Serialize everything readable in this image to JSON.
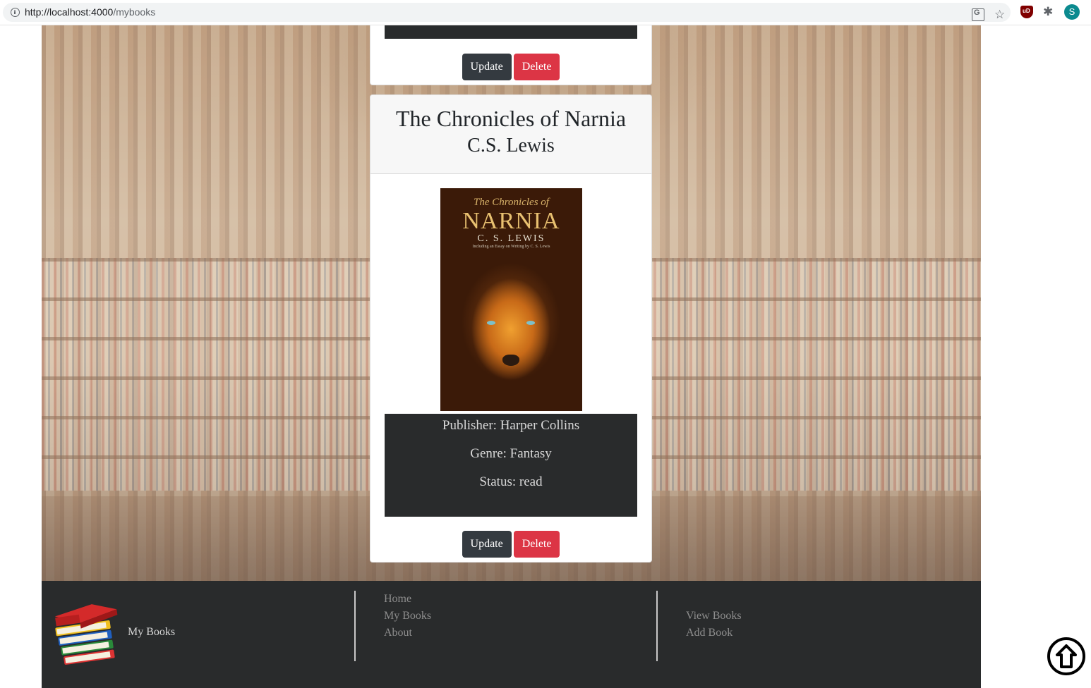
{
  "browser": {
    "url_host": "http://localhost:4000",
    "url_path": "/mybooks",
    "profile_initial": "S"
  },
  "top_card": {
    "update_label": "Update",
    "delete_label": "Delete"
  },
  "book": {
    "title": "The Chronicles of Narnia",
    "author": "C.S. Lewis",
    "cover": {
      "small_title": "The Chronicles of",
      "big_title": "NARNIA",
      "author": "C. S. LEWIS",
      "subtitle": "Including an Essay on Writing by C. S. Lewis"
    },
    "publisher": "Publisher: Harper Collins",
    "genre": "Genre: Fantasy",
    "status": "Status: read",
    "update_label": "Update",
    "delete_label": "Delete"
  },
  "footer": {
    "brand": "My Books",
    "links_col1": [
      "Home",
      "My Books",
      "About"
    ],
    "links_col2": [
      "View Books",
      "Add Book"
    ]
  },
  "colors": {
    "dark": "#343a40",
    "danger": "#dc3545",
    "footer_bg": "#292b2c"
  }
}
